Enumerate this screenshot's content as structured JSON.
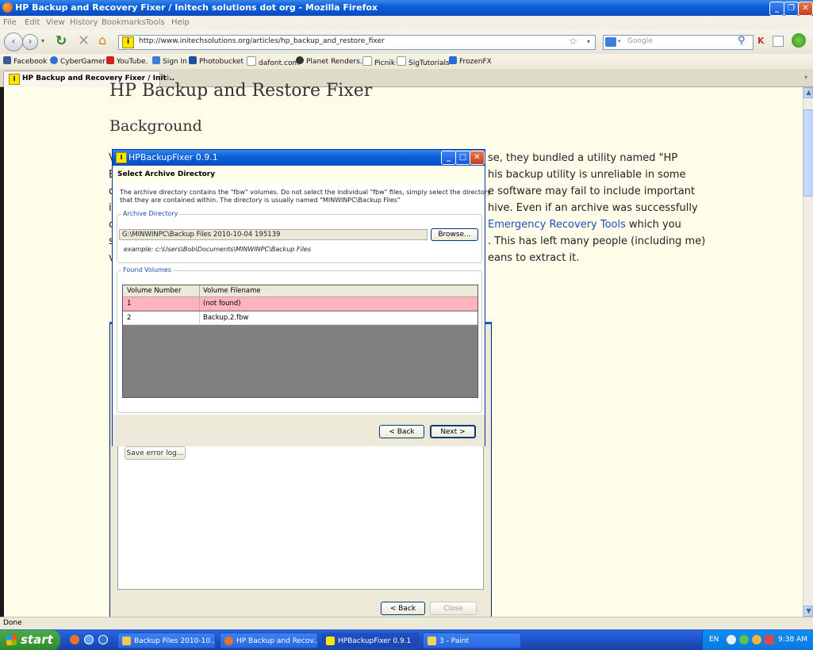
{
  "window": {
    "title": "HP Backup and Recovery Fixer / Initech solutions dot org - Mozilla Firefox"
  },
  "menu": [
    "File",
    "Edit",
    "View",
    "History",
    "Bookmarks",
    "Tools",
    "Help"
  ],
  "address": {
    "url": "http://www.initechsolutions.org/articles/hp_backup_and_restore_fixer",
    "search_placeholder": "Google"
  },
  "bookmarks": [
    {
      "label": "Facebook",
      "color": "#3b5998"
    },
    {
      "label": "CyberGamer",
      "color": "#2c6fd6"
    },
    {
      "label": "YouTube.",
      "color": "#d21f1f"
    },
    {
      "label": "Sign In",
      "color": "#3f7fd8"
    },
    {
      "label": "Photobucket",
      "color": "#1c4fa0"
    },
    {
      "label": "dafont.com",
      "color": "#ffffff"
    },
    {
      "label": "Planet Renders.",
      "color": "#333333"
    },
    {
      "label": "Picnik",
      "color": "#ffffff"
    },
    {
      "label": "SigTutorials",
      "color": "#ffffff"
    },
    {
      "label": "FrozenFX",
      "color": "#2a6ad8"
    }
  ],
  "tab": {
    "label": "HP Backup and Recovery Fixer / Init..."
  },
  "page": {
    "title": "HP Backup and Restore Fixer",
    "subtitle": "Background",
    "lines": [
      "se, they bundled a utility named \"HP",
      "his backup utility is unreliable in some",
      "e software may fail to include important",
      "hive. Even if an archive was successfully",
      "",
      ". This has left many people (including me)",
      "eans to extract it."
    ],
    "link_text": "Emergency Recovery Tools",
    "link_tail": " which you",
    "left_chars": [
      "V",
      "E",
      "c",
      "i",
      "c",
      "s",
      "v"
    ]
  },
  "dialog": {
    "title": "HPBackupFixer 0.9.1",
    "step_title": "Select Archive Directory",
    "description": [
      "The archive directory contains the \"fbw\" volumes. Do not select the individual \"fbw\" files, simply select the directory",
      "that they are contained within. The directory is usually named \"MINWINPC\\Backup Files\""
    ],
    "archive_group": "Archive Directory",
    "path": "G:\\MINWINPC\\Backup Files 2010-10-04 195139",
    "browse": "Browse...",
    "example": "example: c:\\Users\\Bob\\Documents\\MINWINPC\\Backup Files",
    "volumes_group": "Found Volumes",
    "columns": [
      "Volume Number",
      "Volume Filename"
    ],
    "rows": [
      {
        "number": "1",
        "filename": "(not found)",
        "status": "missing"
      },
      {
        "number": "2",
        "filename": "Backup.2.fbw",
        "status": "ok"
      }
    ],
    "back": "< Back",
    "next": "Next >"
  },
  "bg_window": {
    "save_log": "Save error log...",
    "back": "< Back",
    "close": "Close"
  },
  "status": "Done",
  "taskbar": {
    "start": "start",
    "tasks": [
      {
        "label": "Backup Files 2010-10...",
        "color": "#f2c94c"
      },
      {
        "label": "HP Backup and Recov...",
        "color": "#e8742a"
      },
      {
        "label": "HPBackupFixer 0.9.1",
        "color": "#ffe600"
      },
      {
        "label": "3 - Paint",
        "color": "#f5d45a"
      }
    ],
    "lang": "EN",
    "clock": "9:38 AM"
  },
  "colors": {
    "missing_row": "#ffb3bf",
    "link": "#1e4fbf",
    "xp_blue": "#0a5fd8"
  }
}
